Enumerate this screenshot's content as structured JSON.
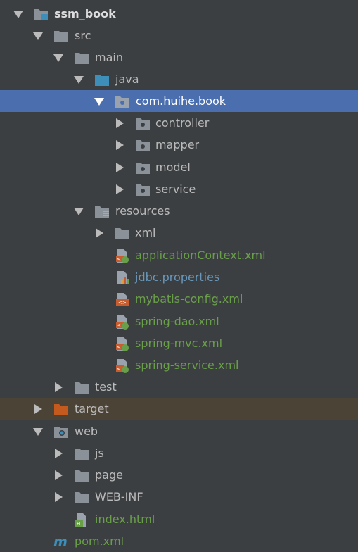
{
  "project_tree": {
    "items": [
      {
        "label": "ssm_book",
        "icon": "module-folder-icon",
        "expanded": true,
        "style": "bold"
      },
      {
        "label": "src",
        "icon": "folder-icon",
        "expanded": true
      },
      {
        "label": "main",
        "icon": "folder-icon",
        "expanded": true
      },
      {
        "label": "java",
        "icon": "source-root-folder-icon",
        "expanded": true
      },
      {
        "label": "com.huihe.book",
        "icon": "package-icon",
        "expanded": true,
        "selected": true
      },
      {
        "label": "controller",
        "icon": "package-icon",
        "expanded": false
      },
      {
        "label": "mapper",
        "icon": "package-icon",
        "expanded": false
      },
      {
        "label": "model",
        "icon": "package-icon",
        "expanded": false
      },
      {
        "label": "service",
        "icon": "package-icon",
        "expanded": false
      },
      {
        "label": "resources",
        "icon": "resources-folder-icon",
        "expanded": true
      },
      {
        "label": "xml",
        "icon": "folder-icon",
        "expanded": false
      },
      {
        "label": "applicationContext.xml",
        "icon": "spring-xml-icon",
        "color": "#6a9f4a"
      },
      {
        "label": "jdbc.properties",
        "icon": "properties-file-icon",
        "color": "#6897bb"
      },
      {
        "label": "mybatis-config.xml",
        "icon": "xml-file-icon",
        "color": "#6a9f4a"
      },
      {
        "label": "spring-dao.xml",
        "icon": "spring-xml-icon",
        "color": "#6a9f4a"
      },
      {
        "label": "spring-mvc.xml",
        "icon": "spring-xml-icon",
        "color": "#6a9f4a"
      },
      {
        "label": "spring-service.xml",
        "icon": "spring-xml-icon",
        "color": "#6a9f4a"
      },
      {
        "label": "test",
        "icon": "folder-icon",
        "expanded": false
      },
      {
        "label": "target",
        "icon": "excluded-folder-icon",
        "expanded": false,
        "excluded": true
      },
      {
        "label": "web",
        "icon": "web-folder-icon",
        "expanded": true
      },
      {
        "label": "js",
        "icon": "folder-icon",
        "expanded": false
      },
      {
        "label": "page",
        "icon": "folder-icon",
        "expanded": false
      },
      {
        "label": "WEB-INF",
        "icon": "folder-icon",
        "expanded": false
      },
      {
        "label": "index.html",
        "icon": "html-file-icon",
        "color": "#6a9f4a"
      },
      {
        "label": "pom.xml",
        "icon": "maven-pom-icon",
        "color": "#6a9f4a"
      }
    ]
  },
  "colors": {
    "background": "#3c3f41",
    "selection": "#4b6eaf",
    "excluded_row": "#4c4337",
    "folder": "#8a9199",
    "source_root": "#3d8eb9",
    "excluded_folder": "#c55a1f",
    "file_green": "#6a9f4a",
    "file_blue": "#6897bb"
  }
}
